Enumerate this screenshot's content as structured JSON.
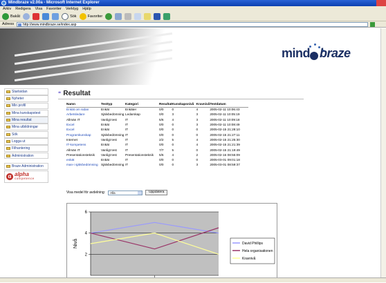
{
  "window": {
    "title": "Mindbraze v2.00a - Microsoft Internet Explorer"
  },
  "menu": [
    "Arkiv",
    "Redigera",
    "Visa",
    "Favoriter",
    "Verktyg",
    "Hjälp"
  ],
  "toolbar": {
    "back": "Bakåt",
    "search": "Sök",
    "favorites": "Favoriter"
  },
  "address": {
    "label": "Adress",
    "url": "http://www.mindbraze.se/index.asp"
  },
  "brand": {
    "name_part1": "mind",
    "name_part2": "braze"
  },
  "sidebar": {
    "items": [
      "Startsidan",
      "Nyheter",
      "Min profil",
      "Mina kunskapstest",
      "Mina resultat",
      "Mina utbildningar",
      "Sök",
      "Logga ut",
      "Filhantering",
      "Administration"
    ],
    "admin_item": "Braze Administration",
    "partner_logo": {
      "word": "alpha",
      "sub": "competence"
    }
  },
  "page": {
    "title": "Resultat"
  },
  "table": {
    "headers": [
      "Namn",
      "Testtyp",
      "Kategori",
      "Resultat",
      "Kunskapsnivå",
      "Kravnivå",
      "Testdatum"
    ],
    "rows": [
      [
        "Enkät om sidan",
        "Enkät",
        "Enkäter",
        "0/0",
        "0",
        "4",
        "2005-02-11 10:06:43"
      ],
      [
        "Arbetsledare",
        "Självbedömning",
        "Ledarskap",
        "0/0",
        "3",
        "3",
        "2005-02-11 10:05:19"
      ],
      [
        "Allmän IT",
        "Vanligt test",
        "IT",
        "5/6",
        "4",
        "3",
        "2005-02-11 10:09:18"
      ],
      [
        "Excel",
        "Enkät",
        "IT",
        "0/0",
        "0",
        "3",
        "2005-02-11 10:08:49"
      ],
      [
        "Excel",
        "Enkät",
        "IT",
        "0/0",
        "0",
        "0",
        "2005-02-15 21:28:10"
      ],
      [
        "Programkunskap",
        "Självbedömning",
        "IT",
        "0/0",
        "0",
        "0",
        "2005-02-15 21:27:11"
      ],
      [
        "Internet",
        "Vanligt test",
        "IT",
        "2/2",
        "5",
        "4",
        "2005-02-15 21:25:30"
      ],
      [
        "IT-kompetens",
        "Enkät",
        "IT",
        "0/0",
        "0",
        "4",
        "2005-02-15 21:21:39"
      ],
      [
        "Allmän IT",
        "Vanligt test",
        "IT",
        "7/7",
        "5",
        "0",
        "2005-02-15 21:19:49"
      ],
      [
        "Presentationsteknik",
        "Vanligt test",
        "Presentationsteknik",
        "5/6",
        "4",
        "2",
        "2005-02-16 08:55:09"
      ],
      [
        "enkät",
        "Enkät",
        "IT",
        "0/0",
        "0",
        "0",
        "2005-03-01 09:01:18"
      ],
      [
        "man-i självbedömning",
        "Självbedömning",
        "IT",
        "0/0",
        "0",
        "3",
        "2005-03-01 08:59:37"
      ]
    ],
    "link_rows": [
      0,
      1,
      3,
      4,
      5,
      7,
      10,
      11
    ]
  },
  "filter": {
    "label": "Visa medel för avdelning:",
    "selected": "Alla",
    "button": "Uppdatera"
  },
  "chart_data": {
    "type": "line",
    "ylabel": "Nivå",
    "xlabel": "",
    "ylim": [
      0,
      6
    ],
    "yticks": [
      2,
      4,
      6
    ],
    "x": [
      0,
      1,
      2
    ],
    "series": [
      {
        "name": "David Phillips",
        "color": "#9999ff",
        "values": [
          4,
          5,
          4
        ]
      },
      {
        "name": "Hela organisationen",
        "color": "#993366",
        "values": [
          4,
          2.5,
          4.5
        ]
      },
      {
        "name": "Kravnivå",
        "color": "#ffff99",
        "values": [
          3,
          4,
          2
        ]
      }
    ]
  }
}
